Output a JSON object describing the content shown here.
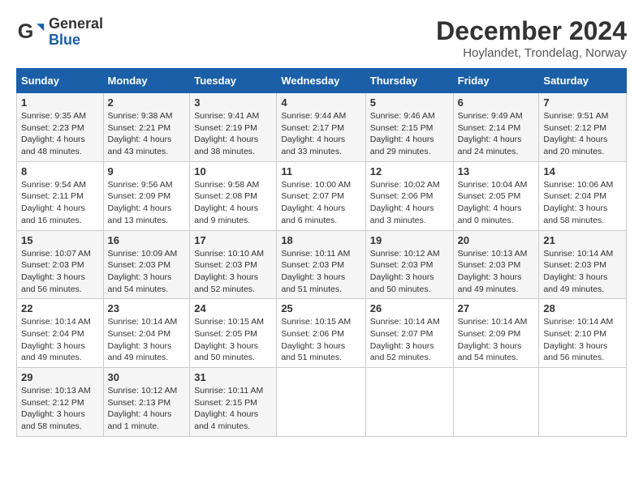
{
  "header": {
    "logo_general": "General",
    "logo_blue": "Blue",
    "month_title": "December 2024",
    "location": "Hoylandet, Trondelag, Norway"
  },
  "days_of_week": [
    "Sunday",
    "Monday",
    "Tuesday",
    "Wednesday",
    "Thursday",
    "Friday",
    "Saturday"
  ],
  "weeks": [
    [
      {
        "day": "1",
        "sunrise": "9:35 AM",
        "sunset": "2:23 PM",
        "daylight": "4 hours and 48 minutes."
      },
      {
        "day": "2",
        "sunrise": "9:38 AM",
        "sunset": "2:21 PM",
        "daylight": "4 hours and 43 minutes."
      },
      {
        "day": "3",
        "sunrise": "9:41 AM",
        "sunset": "2:19 PM",
        "daylight": "4 hours and 38 minutes."
      },
      {
        "day": "4",
        "sunrise": "9:44 AM",
        "sunset": "2:17 PM",
        "daylight": "4 hours and 33 minutes."
      },
      {
        "day": "5",
        "sunrise": "9:46 AM",
        "sunset": "2:15 PM",
        "daylight": "4 hours and 29 minutes."
      },
      {
        "day": "6",
        "sunrise": "9:49 AM",
        "sunset": "2:14 PM",
        "daylight": "4 hours and 24 minutes."
      },
      {
        "day": "7",
        "sunrise": "9:51 AM",
        "sunset": "2:12 PM",
        "daylight": "4 hours and 20 minutes."
      }
    ],
    [
      {
        "day": "8",
        "sunrise": "9:54 AM",
        "sunset": "2:11 PM",
        "daylight": "4 hours and 16 minutes."
      },
      {
        "day": "9",
        "sunrise": "9:56 AM",
        "sunset": "2:09 PM",
        "daylight": "4 hours and 13 minutes."
      },
      {
        "day": "10",
        "sunrise": "9:58 AM",
        "sunset": "2:08 PM",
        "daylight": "4 hours and 9 minutes."
      },
      {
        "day": "11",
        "sunrise": "10:00 AM",
        "sunset": "2:07 PM",
        "daylight": "4 hours and 6 minutes."
      },
      {
        "day": "12",
        "sunrise": "10:02 AM",
        "sunset": "2:06 PM",
        "daylight": "4 hours and 3 minutes."
      },
      {
        "day": "13",
        "sunrise": "10:04 AM",
        "sunset": "2:05 PM",
        "daylight": "4 hours and 0 minutes."
      },
      {
        "day": "14",
        "sunrise": "10:06 AM",
        "sunset": "2:04 PM",
        "daylight": "3 hours and 58 minutes."
      }
    ],
    [
      {
        "day": "15",
        "sunrise": "10:07 AM",
        "sunset": "2:03 PM",
        "daylight": "3 hours and 56 minutes."
      },
      {
        "day": "16",
        "sunrise": "10:09 AM",
        "sunset": "2:03 PM",
        "daylight": "3 hours and 54 minutes."
      },
      {
        "day": "17",
        "sunrise": "10:10 AM",
        "sunset": "2:03 PM",
        "daylight": "3 hours and 52 minutes."
      },
      {
        "day": "18",
        "sunrise": "10:11 AM",
        "sunset": "2:03 PM",
        "daylight": "3 hours and 51 minutes."
      },
      {
        "day": "19",
        "sunrise": "10:12 AM",
        "sunset": "2:03 PM",
        "daylight": "3 hours and 50 minutes."
      },
      {
        "day": "20",
        "sunrise": "10:13 AM",
        "sunset": "2:03 PM",
        "daylight": "3 hours and 49 minutes."
      },
      {
        "day": "21",
        "sunrise": "10:14 AM",
        "sunset": "2:03 PM",
        "daylight": "3 hours and 49 minutes."
      }
    ],
    [
      {
        "day": "22",
        "sunrise": "10:14 AM",
        "sunset": "2:04 PM",
        "daylight": "3 hours and 49 minutes."
      },
      {
        "day": "23",
        "sunrise": "10:14 AM",
        "sunset": "2:04 PM",
        "daylight": "3 hours and 49 minutes."
      },
      {
        "day": "24",
        "sunrise": "10:15 AM",
        "sunset": "2:05 PM",
        "daylight": "3 hours and 50 minutes."
      },
      {
        "day": "25",
        "sunrise": "10:15 AM",
        "sunset": "2:06 PM",
        "daylight": "3 hours and 51 minutes."
      },
      {
        "day": "26",
        "sunrise": "10:14 AM",
        "sunset": "2:07 PM",
        "daylight": "3 hours and 52 minutes."
      },
      {
        "day": "27",
        "sunrise": "10:14 AM",
        "sunset": "2:09 PM",
        "daylight": "3 hours and 54 minutes."
      },
      {
        "day": "28",
        "sunrise": "10:14 AM",
        "sunset": "2:10 PM",
        "daylight": "3 hours and 56 minutes."
      }
    ],
    [
      {
        "day": "29",
        "sunrise": "10:13 AM",
        "sunset": "2:12 PM",
        "daylight": "3 hours and 58 minutes."
      },
      {
        "day": "30",
        "sunrise": "10:12 AM",
        "sunset": "2:13 PM",
        "daylight": "4 hours and 1 minute."
      },
      {
        "day": "31",
        "sunrise": "10:11 AM",
        "sunset": "2:15 PM",
        "daylight": "4 hours and 4 minutes."
      },
      null,
      null,
      null,
      null
    ]
  ],
  "labels": {
    "sunrise_prefix": "Sunrise: ",
    "sunset_prefix": "Sunset: ",
    "daylight_prefix": "Daylight: "
  }
}
